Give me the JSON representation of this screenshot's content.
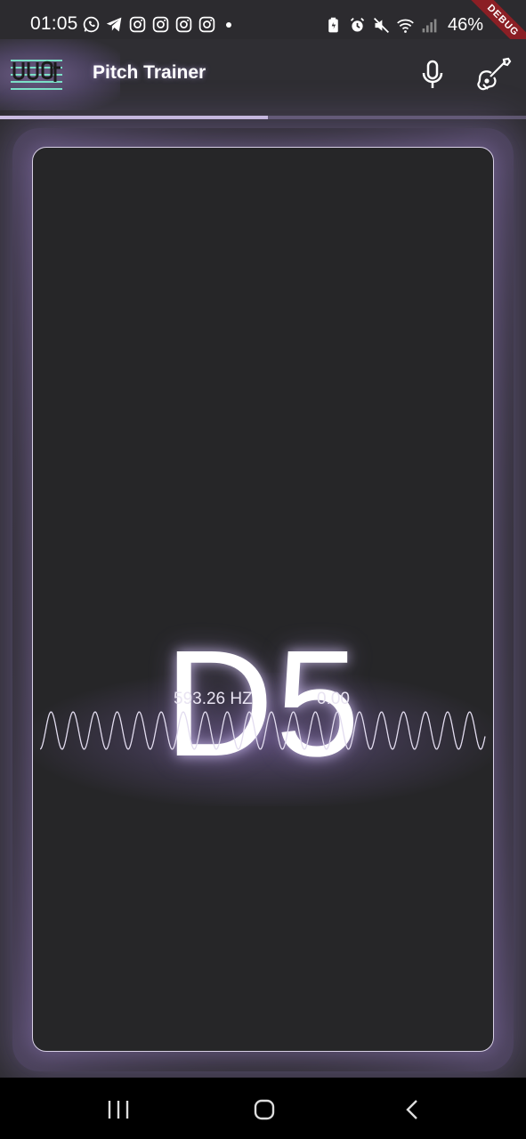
{
  "status_bar": {
    "time": "01:05",
    "battery": "46%",
    "notification_icons": [
      "whatsapp-icon",
      "telegram-icon",
      "instagram-icon",
      "instagram-icon",
      "instagram-icon",
      "instagram-icon"
    ],
    "system_icons": [
      "battery-saver-icon",
      "alarm-icon",
      "mute-icon",
      "wifi-icon",
      "signal-icon"
    ]
  },
  "debug_banner": "DEBUG",
  "app_bar": {
    "title": "Pitch Trainer",
    "actions": [
      "mic-icon",
      "guitar-icon"
    ]
  },
  "progress": {
    "fraction": 0.51
  },
  "tuner": {
    "note": "D5",
    "frequency": "593.26 HZ",
    "cents": "0.00"
  },
  "nav_bar": {
    "buttons": [
      "recents-icon",
      "home-icon",
      "back-icon"
    ]
  },
  "colors": {
    "background": "#2c2b2f",
    "card": "#262628",
    "accent_glow": "#9a84c4",
    "text": "#ffffff",
    "progress_fill": "#cfc2e4",
    "progress_track": "#5b546a"
  }
}
